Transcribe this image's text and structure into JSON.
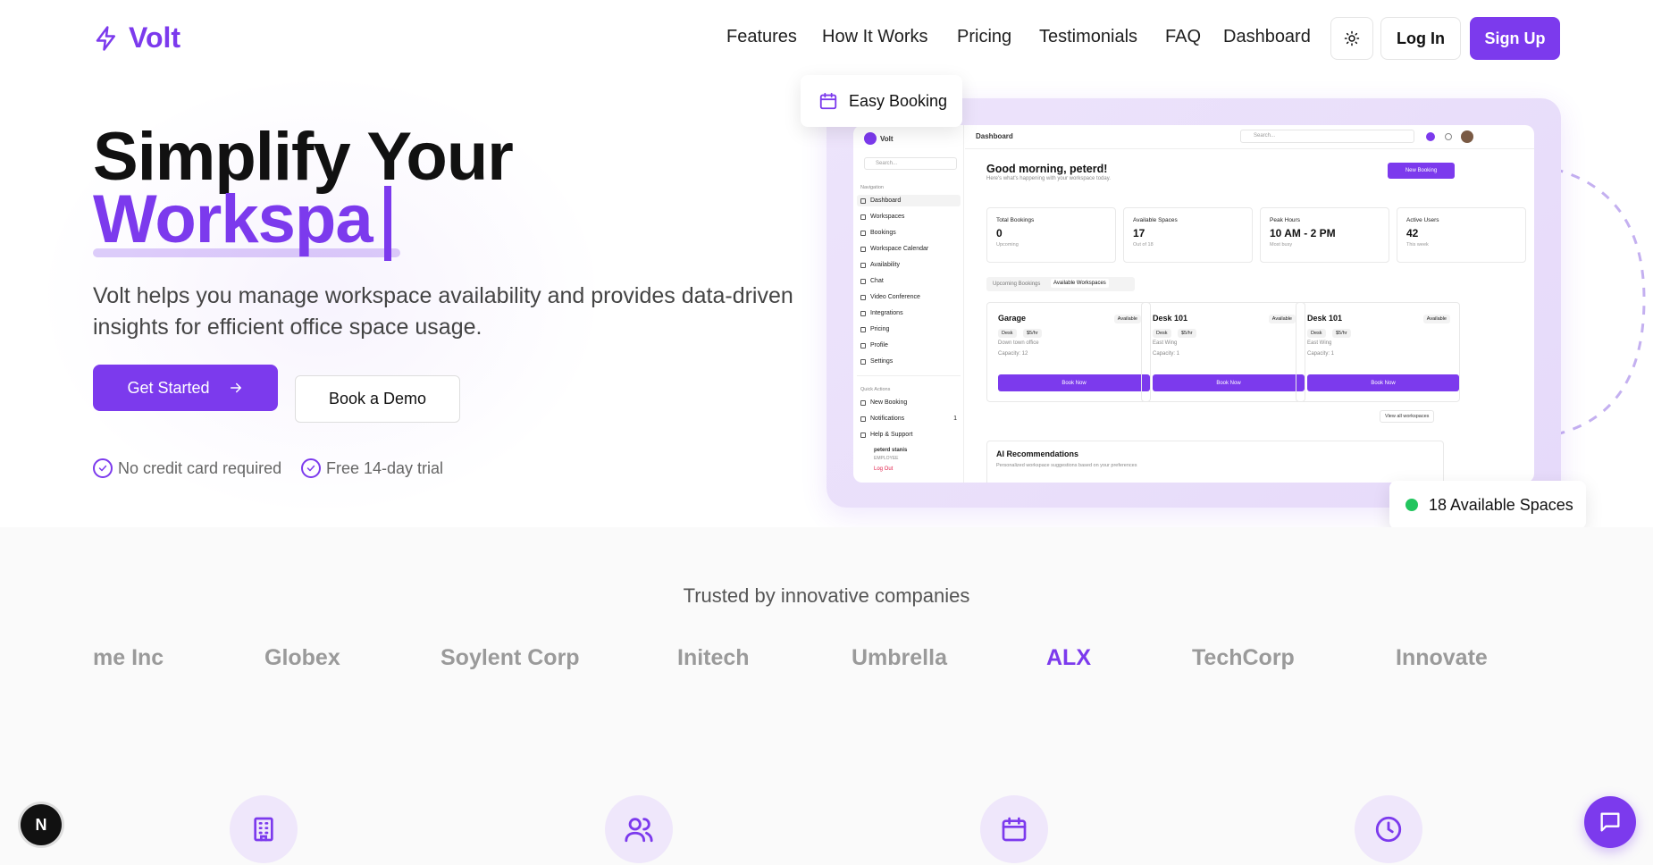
{
  "brand": {
    "name": "Volt",
    "accent": "#7c3aed"
  },
  "nav": {
    "links": [
      "Features",
      "How It Works",
      "Pricing",
      "Testimonials",
      "FAQ",
      "Dashboard"
    ],
    "login": "Log In",
    "signup": "Sign Up"
  },
  "hero": {
    "title_line1": "Simplify Your",
    "title_line2": "Workspa",
    "subtitle": "Volt helps you manage workspace availability and provides data-driven insights for efficient office space usage.",
    "primary_cta": "Get Started",
    "secondary_cta": "Book a Demo",
    "perks": [
      "No credit card required",
      "Free 14-day trial"
    ]
  },
  "floating": {
    "booking": "Easy Booking",
    "spaces": "18 Available Spaces"
  },
  "dashboard": {
    "brand": "Volt",
    "title": "Dashboard",
    "search_placeholder": "Search...",
    "side_search": "Search...",
    "nav_heading": "Navigation",
    "nav_items": [
      "Dashboard",
      "Workspaces",
      "Bookings",
      "Workspace Calendar",
      "Availability",
      "Chat",
      "Video Conference",
      "Integrations",
      "Pricing",
      "Profile",
      "Settings"
    ],
    "quick_heading": "Quick Actions",
    "quick_items": [
      "New Booking",
      "Notifications",
      "Help & Support"
    ],
    "notif_count": "1",
    "user_name": "peterd stanis",
    "user_role": "EMPLOYEE",
    "logout": "Log Out",
    "greeting": "Good morning, peterd!",
    "greeting_sub": "Here's what's happening with your workspace today.",
    "new_booking": "New Booking",
    "stats": [
      {
        "label": "Total Bookings",
        "value": "0",
        "note": "Upcoming"
      },
      {
        "label": "Available Spaces",
        "value": "17",
        "note": "Out of 18"
      },
      {
        "label": "Peak Hours",
        "value": "10 AM - 2 PM",
        "note": "Most busy"
      },
      {
        "label": "Active Users",
        "value": "42",
        "note": "This week"
      }
    ],
    "tabs": [
      "Upcoming Bookings",
      "Available Workspaces"
    ],
    "workspaces": [
      {
        "name": "Garage",
        "status": "Available",
        "type": "Desk",
        "price": "$5/hr",
        "location": "Down town office",
        "capacity": "Capacity: 12",
        "cta": "Book Now"
      },
      {
        "name": "Desk 101",
        "status": "Available",
        "type": "Desk",
        "price": "$5/hr",
        "location": "East Wing",
        "capacity": "Capacity: 1",
        "cta": "Book Now"
      },
      {
        "name": "Desk 101",
        "status": "Available",
        "type": "Desk",
        "price": "$5/hr",
        "location": "East Wing",
        "capacity": "Capacity: 1",
        "cta": "Book Now"
      }
    ],
    "view_all": "View all workspaces",
    "ai_title": "AI Recommendations",
    "ai_sub": "Personalized workspace suggestions based on your preferences"
  },
  "trusted": {
    "title": "Trusted by innovative companies",
    "companies": [
      "me Inc",
      "Globex",
      "Soylent Corp",
      "Initech",
      "Umbrella",
      "ALX",
      "TechCorp",
      "Innovate"
    ],
    "highlight_color": "#7c3aed"
  },
  "features_icons": [
    "building-icon",
    "users-icon",
    "calendar-icon",
    "clock-icon"
  ],
  "next_badge": "N"
}
